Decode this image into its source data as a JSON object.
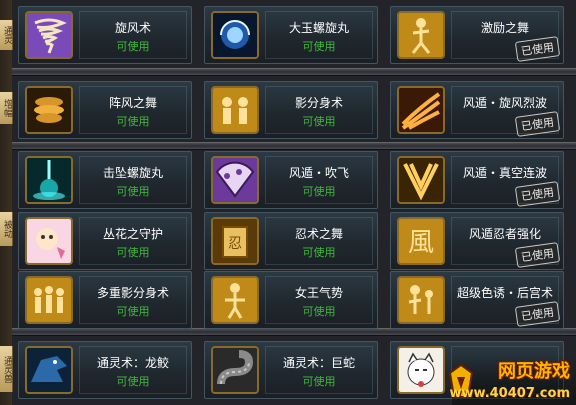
{
  "sections": [
    {
      "tag": "通灵"
    },
    {
      "tag": "增幅"
    },
    {
      "tag": "被动"
    },
    {
      "tag": "通灵兽"
    }
  ],
  "skills": [
    {
      "name": "旋风术",
      "status": "可使用",
      "stamp": "",
      "icon": "tornado-icon",
      "color": "#7a4ab8"
    },
    {
      "name": "大玉螺旋丸",
      "status": "可使用",
      "stamp": "",
      "icon": "rasengan-icon",
      "color": "#1e5aa8"
    },
    {
      "name": "激励之舞",
      "status": "",
      "stamp": "已使用",
      "icon": "dancer-icon",
      "color": "#c08a18"
    },
    {
      "name": "阵风之舞",
      "status": "可使用",
      "stamp": "",
      "icon": "whirl-icon",
      "color": "#d8952a"
    },
    {
      "name": "影分身术",
      "status": "可使用",
      "stamp": "",
      "icon": "clones-icon",
      "color": "#c08a18"
    },
    {
      "name": "风遁・旋风烈波",
      "status": "",
      "stamp": "已使用",
      "icon": "wind-wave-icon",
      "color": "#d0701a"
    },
    {
      "name": "击坠螺旋丸",
      "status": "可使用",
      "stamp": "",
      "icon": "falling-rasengan-icon",
      "color": "#19a6a8"
    },
    {
      "name": "风遁・吹飞",
      "status": "可使用",
      "stamp": "",
      "icon": "fan-icon",
      "color": "#6b3a9a"
    },
    {
      "name": "风遁・真空连波",
      "status": "",
      "stamp": "已使用",
      "icon": "vacuum-wave-icon",
      "color": "#c08a18"
    },
    {
      "name": "丛花之守护",
      "status": "可使用",
      "stamp": "",
      "icon": "flower-guard-icon",
      "color": "#e06a9a"
    },
    {
      "name": "忍术之舞",
      "status": "可使用",
      "stamp": "",
      "icon": "scroll-icon",
      "color": "#c08a18"
    },
    {
      "name": "风遁忍者强化",
      "status": "",
      "stamp": "已使用",
      "icon": "wind-kanji-icon",
      "color": "#c08a18"
    },
    {
      "name": "多重影分身术",
      "status": "可使用",
      "stamp": "",
      "icon": "multi-clones-icon",
      "color": "#c08a18"
    },
    {
      "name": "女王气势",
      "status": "可使用",
      "stamp": "",
      "icon": "queen-icon",
      "color": "#c08a18"
    },
    {
      "name": "超级色诱・后宫术",
      "status": "",
      "stamp": "已使用",
      "icon": "harem-icon",
      "color": "#c08a18"
    },
    {
      "name": "通灵术：龙鲛",
      "status": "可使用",
      "stamp": "",
      "icon": "dragon-shark-icon",
      "color": "#2a6aa8"
    },
    {
      "name": "通灵术：巨蛇",
      "status": "可使用",
      "stamp": "",
      "icon": "snake-icon",
      "color": "#8a8a8a"
    },
    {
      "name": "",
      "status": "",
      "stamp": "",
      "icon": "cat-icon",
      "color": "#d84040"
    }
  ],
  "watermark": {
    "title": "网页游戏",
    "url": "www.40407.com"
  }
}
